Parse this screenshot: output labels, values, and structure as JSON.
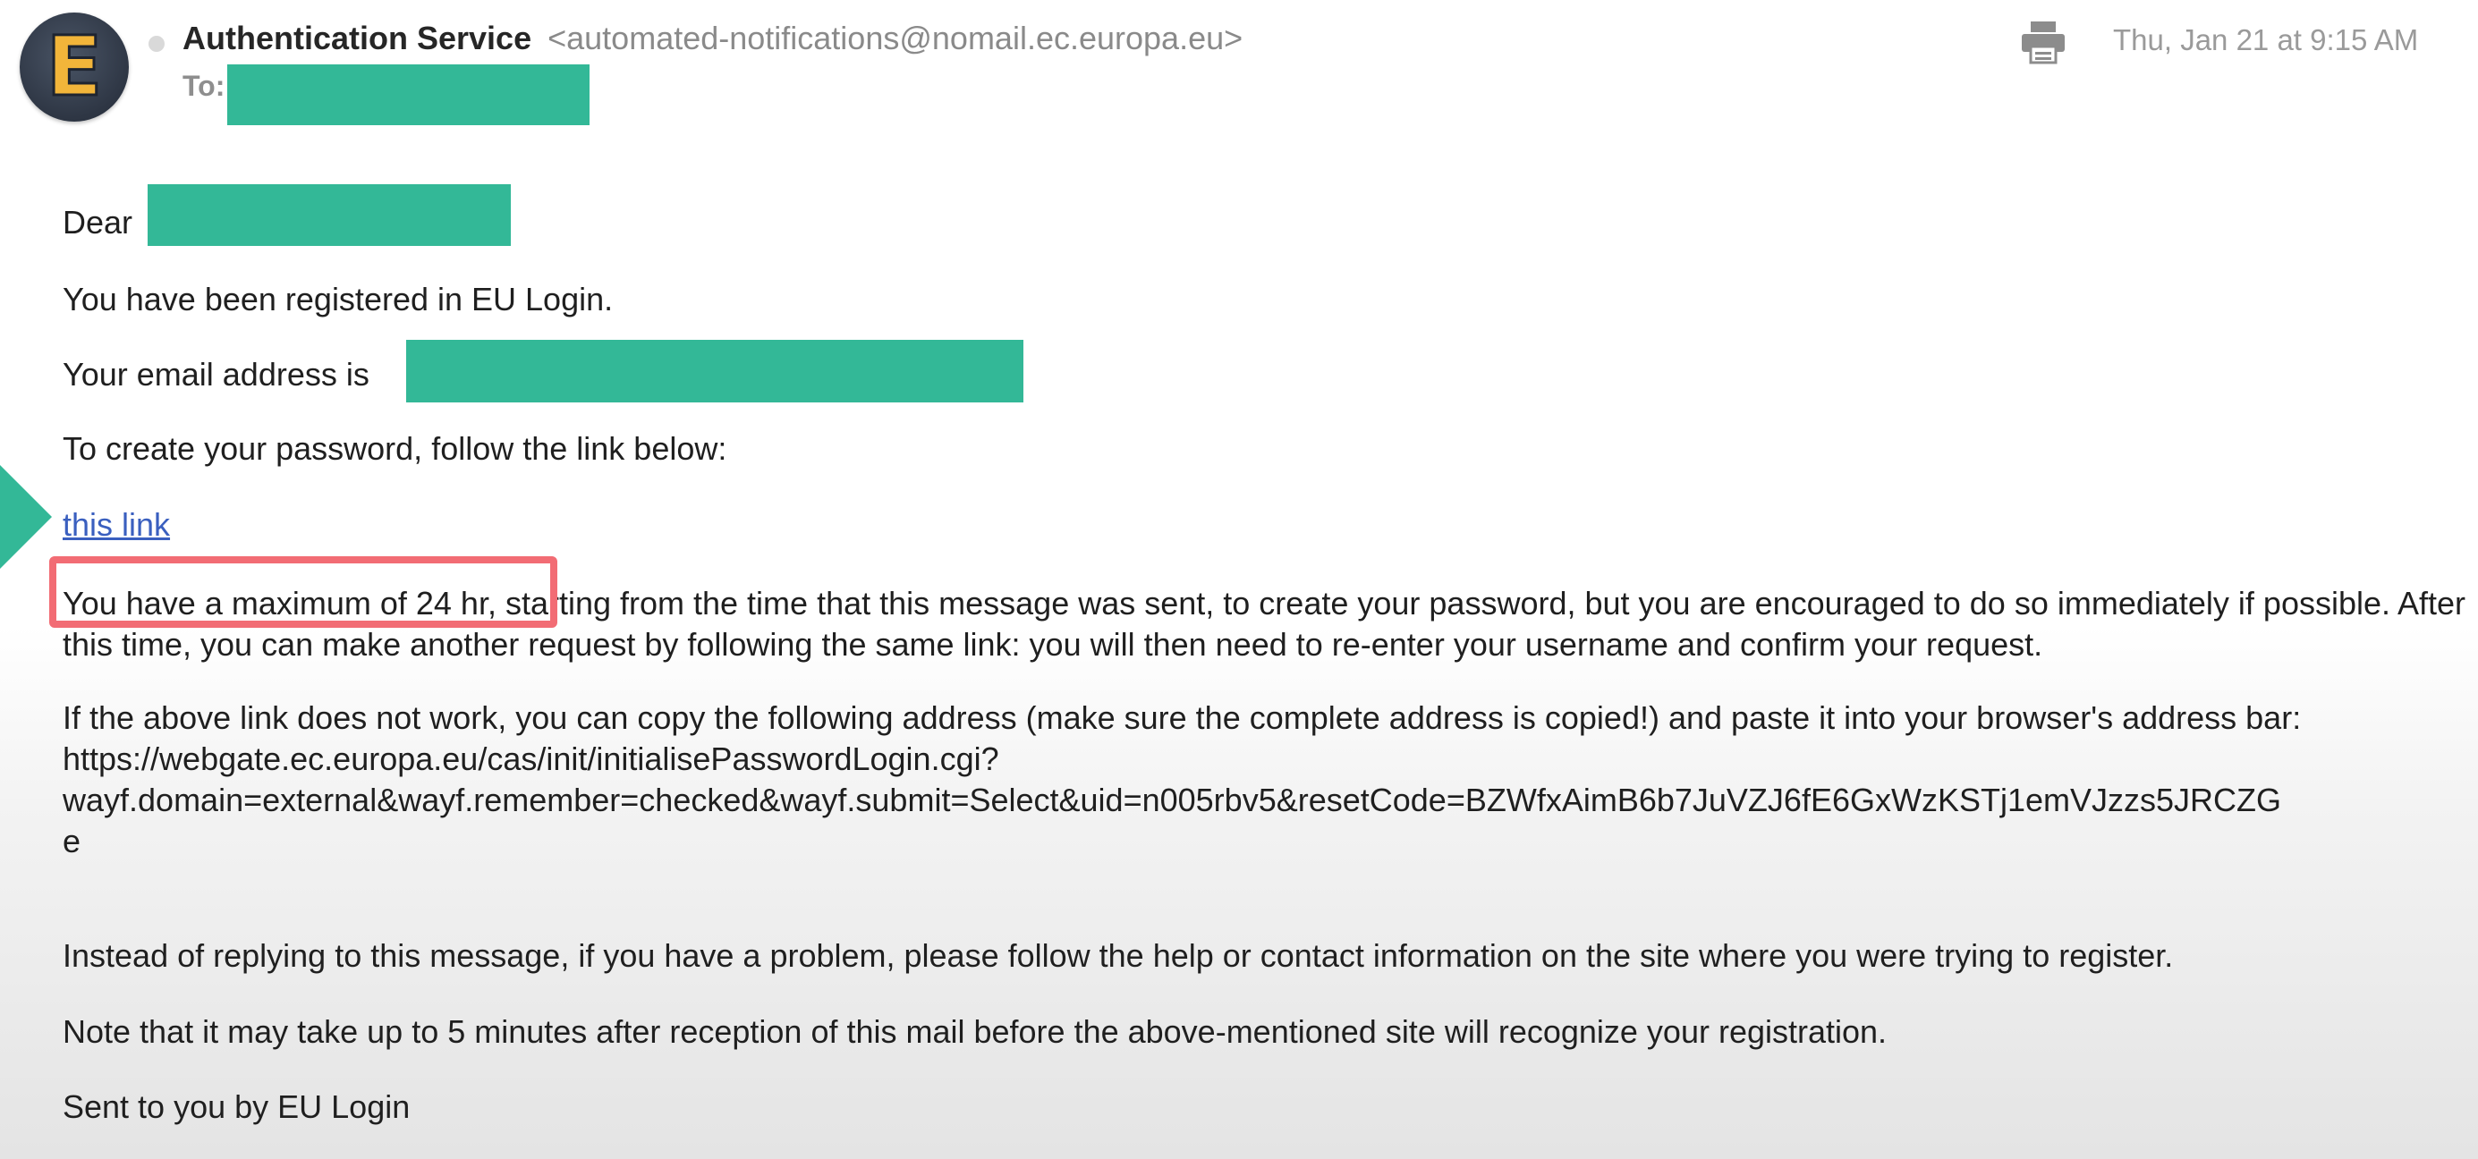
{
  "header": {
    "avatar_letter": "E",
    "sender_name": "Authentication Service",
    "sender_email": "<automated-notifications@nomail.ec.europa.eu>",
    "to_label": "To:",
    "date": "Thu, Jan 21 at 9:15 AM",
    "print_icon": "printer-icon"
  },
  "message": {
    "greeting": "Dear",
    "registered": "You have been registered in EU Login.",
    "email_intro": "Your email address is",
    "create_password": "To create your password, follow the link below:",
    "link_text": "this link",
    "max_time": "You have a maximum of 24 hr, starting from the time that this message was sent, to create your password, but you are encouraged to do so immediately if possible. After this time, you can make another request by following the same link: you will then need to re-enter your username and confirm your request.",
    "fallback_intro": "If the above link does not work, you can copy the following address (make sure the complete address is copied!) and paste it into your browser's address bar:",
    "url_line1": "https://webgate.ec.europa.eu/cas/init/initialisePasswordLogin.cgi?",
    "url_line2": "wayf.domain=external&wayf.remember=checked&wayf.submit=Select&uid=n005rbv5&resetCode=BZWfxAimB6b7JuVZJ6fE6GxWzKSTj1emVJzzs5JRCZG",
    "url_line3": "e",
    "no_reply": "Instead of replying to this message, if you have a problem, please follow the help or contact information on the site where you were trying to register.",
    "delay_note": "Note that it may take up to 5 minutes after reception of this mail before the above-mentioned site will recognize your registration.",
    "signature": "Sent to you by EU Login"
  },
  "colors": {
    "redaction": "#33b897",
    "highlight_box": "#f26c74",
    "pointer_arrow": "#33b897",
    "link": "#3a5fbf"
  }
}
